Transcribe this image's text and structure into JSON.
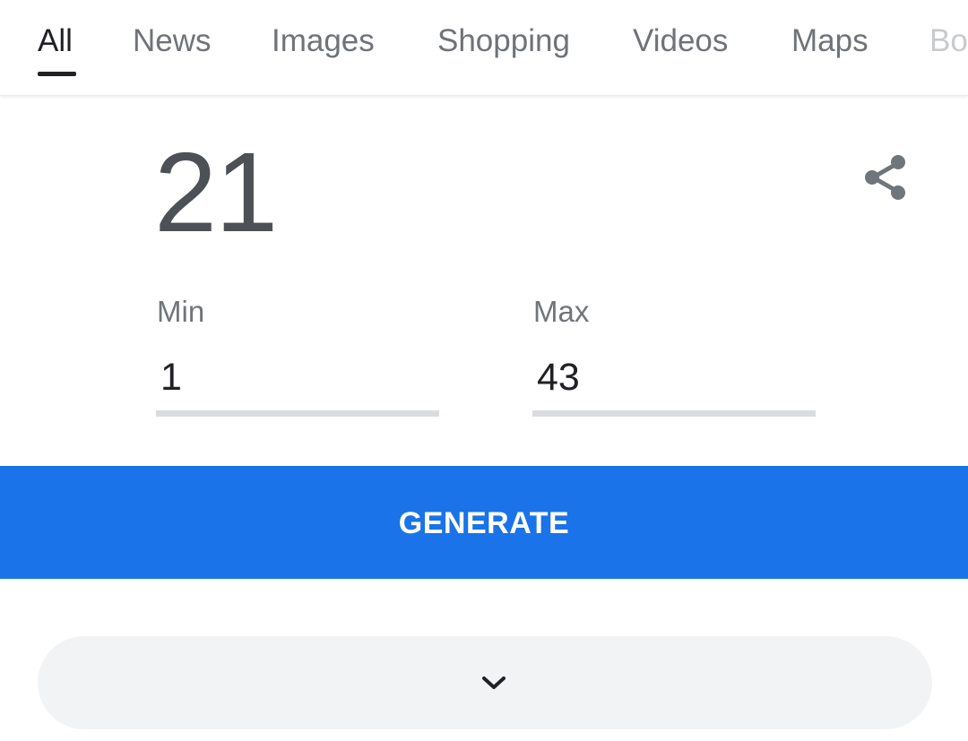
{
  "tabs": [
    {
      "label": "All",
      "active": true
    },
    {
      "label": "News",
      "active": false
    },
    {
      "label": "Images",
      "active": false
    },
    {
      "label": "Shopping",
      "active": false
    },
    {
      "label": "Videos",
      "active": false
    },
    {
      "label": "Maps",
      "active": false
    },
    {
      "label": "Bo",
      "active": false
    }
  ],
  "generator": {
    "result": "21",
    "min": {
      "label": "Min",
      "value": "1"
    },
    "max": {
      "label": "Max",
      "value": "43"
    },
    "generate_label": "GENERATE",
    "share_icon": "share-icon",
    "expand_icon": "chevron-down-icon"
  },
  "colors": {
    "accent": "#1a73e8",
    "text_primary": "#202124",
    "text_secondary": "#70757a",
    "result_text": "#4d5156",
    "input_underline": "#dadce0",
    "expand_bg": "#f1f3f4"
  }
}
